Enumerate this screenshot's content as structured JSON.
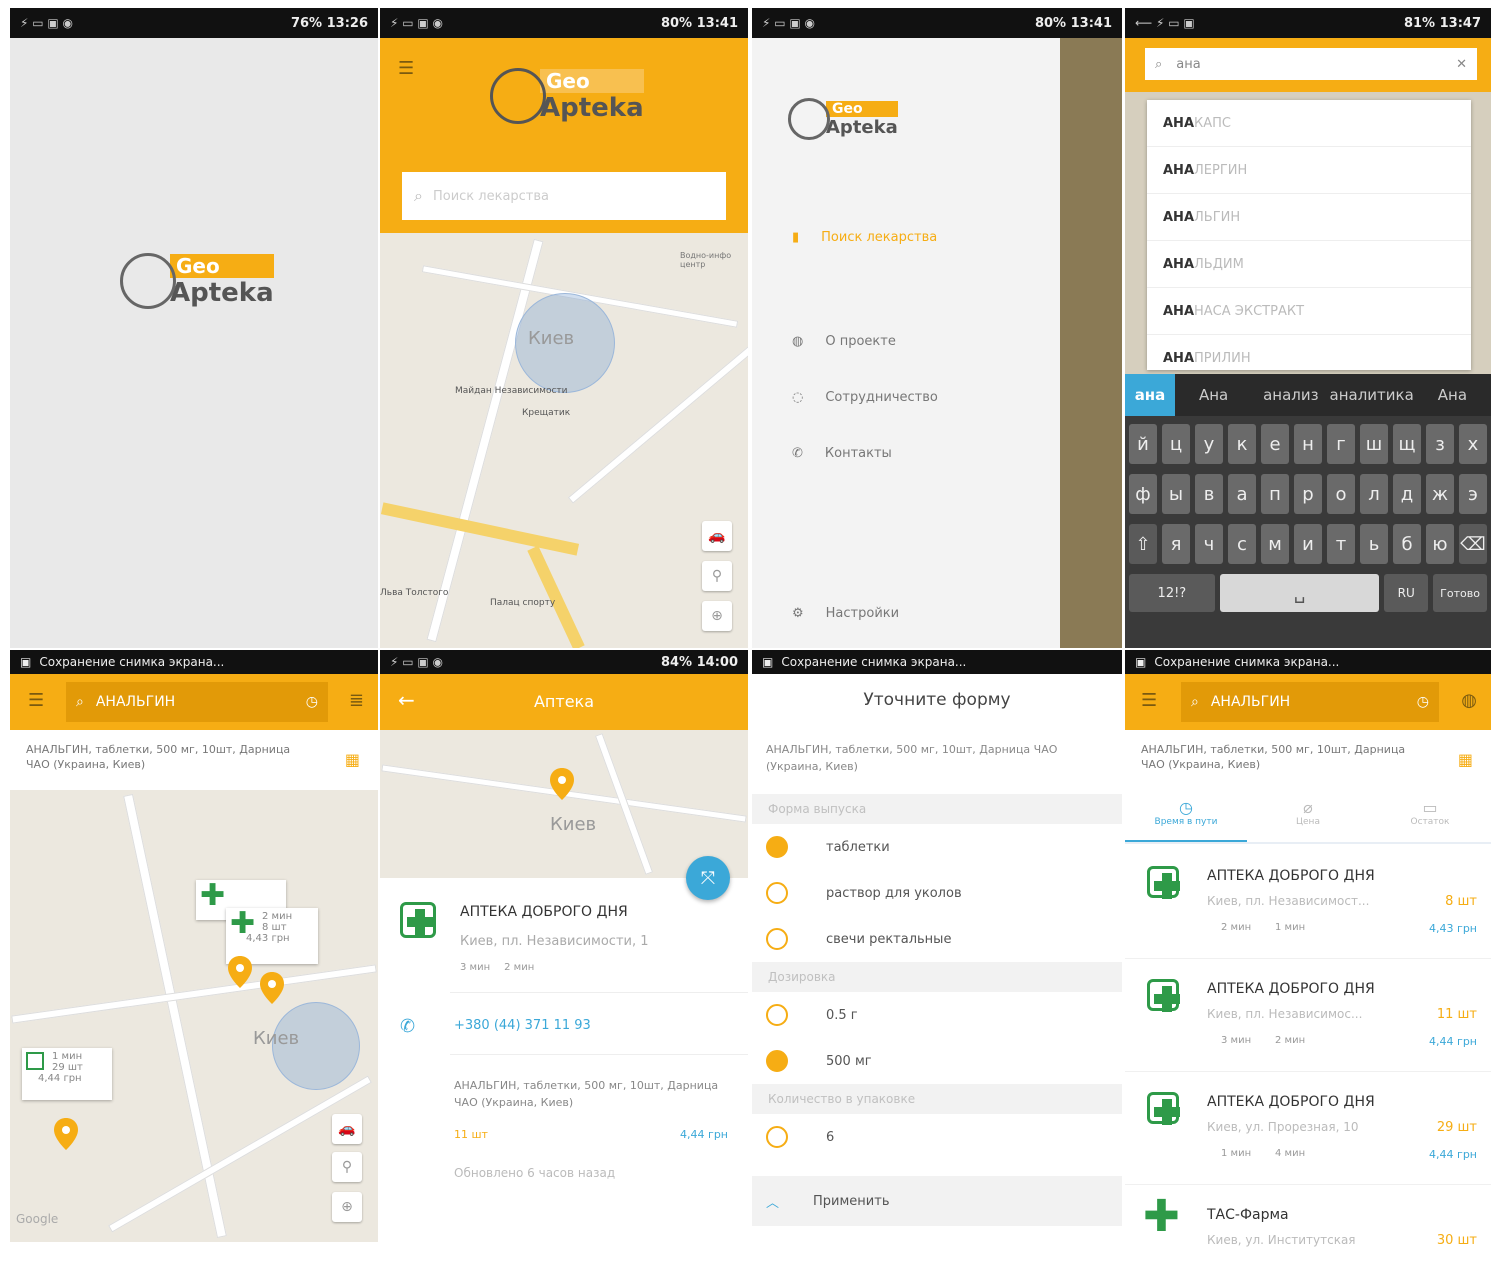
{
  "logo": {
    "geo": "Geo",
    "apteka": "Apteka"
  },
  "status": {
    "s1_time": "13:26",
    "s1_battery": "76%",
    "s2_time": "13:41",
    "s2_battery": "80%",
    "s3_time": "13:41",
    "s3_battery": "80%",
    "s4_time": "13:47",
    "s4_battery": "81%",
    "s6_time": "14:00",
    "s6_battery": "84%"
  },
  "screenshot_notice": "Сохранение снимка экрана...",
  "search": {
    "placeholder": "Поиск лекарства",
    "query": "ана",
    "query_full": "АНАЛЬГИН"
  },
  "map": {
    "city": "Киев",
    "place1": "Майдан Независимости",
    "place2": "Крещатик",
    "place3": "Льва Толстого",
    "place4": "Палац спорту",
    "place5": "Водно-инфо центр",
    "google": "Google"
  },
  "drawer": {
    "search_drugs": "Поиск лекарства",
    "about": "О проекте",
    "cooperation": "Сотрудничество",
    "contacts": "Контакты",
    "settings": "Настройки"
  },
  "suggestions": {
    "prefix": "АНА",
    "items": [
      "КАПС",
      "ЛЕРГИН",
      "ЛЬГИН",
      "ЛЬДИМ",
      "НАСА ЭКСТРАКТ",
      "ПРИЛИН"
    ]
  },
  "keyboard": {
    "predictions": [
      "ана",
      "Ана",
      "анализ",
      "аналитика",
      "Ана"
    ],
    "row1": [
      "й",
      "ц",
      "у",
      "к",
      "е",
      "н",
      "г",
      "ш",
      "щ",
      "з",
      "х"
    ],
    "row2": [
      "ф",
      "ы",
      "в",
      "а",
      "п",
      "р",
      "о",
      "л",
      "д",
      "ж",
      "э"
    ],
    "row3": [
      "я",
      "ч",
      "с",
      "м",
      "и",
      "т",
      "ь",
      "б",
      "ю"
    ],
    "sym": "12!?",
    "lang": "RU",
    "go": "Готово"
  },
  "drug": {
    "desc": "АНАЛЬГИН, таблетки, 500 мг, 10шт, Дарница ЧАО (Украина, Киев)"
  },
  "map_markers": [
    {
      "walk": "2 мин",
      "qty": "8 шт",
      "price": "4,43 грн"
    },
    {
      "walk": "1 мин",
      "qty": "29 шт",
      "price": "4,44 грн"
    }
  ],
  "pharmacy_detail": {
    "title": "Аптека",
    "name": "АПТЕКА ДОБРОГО ДНЯ",
    "address": "Киев, пл. Независимости, 1",
    "walk": "3 мин",
    "drive": "2 мин",
    "phone": "+380 (44) 371 11 93",
    "qty": "11 шт",
    "price": "4,44 грн",
    "updated": "Обновлено 6 часов назад"
  },
  "form": {
    "title": "Уточните форму",
    "sec_form": "Форма выпуска",
    "opts_form": [
      {
        "label": "таблетки",
        "on": true
      },
      {
        "label": "раствор для уколов",
        "on": false
      },
      {
        "label": "свечи ректальные",
        "on": false
      }
    ],
    "sec_dose": "Дозировка",
    "opts_dose": [
      {
        "label": "0.5 г",
        "on": false
      },
      {
        "label": "500 мг",
        "on": true
      }
    ],
    "sec_qty": "Количество в упаковке",
    "opts_qty": [
      {
        "label": "6",
        "on": false
      }
    ],
    "apply": "Применить"
  },
  "tabs": [
    "Время в пути",
    "Цена",
    "Остаток"
  ],
  "pharmacies": [
    {
      "name": "АПТЕКА ДОБРОГО ДНЯ",
      "addr": "Киев, пл. Независимост...",
      "qty": "8 шт",
      "walk": "2 мин",
      "drive": "1 мин",
      "price": "4,43 грн"
    },
    {
      "name": "АПТЕКА ДОБРОГО ДНЯ",
      "addr": "Киев, пл. Независимос...",
      "qty": "11 шт",
      "walk": "3 мин",
      "drive": "2 мин",
      "price": "4,44 грн"
    },
    {
      "name": "АПТЕКА ДОБРОГО ДНЯ",
      "addr": "Киев, ул. Прорезная, 10",
      "qty": "29 шт",
      "walk": "1 мин",
      "drive": "4 мин",
      "price": "4,44 грн"
    },
    {
      "name": "ТАС-Фарма",
      "addr": "Киев, ул. Институтская",
      "qty": "30 шт",
      "walk": "",
      "drive": "",
      "price": ""
    }
  ],
  "colors": {
    "accent": "#f6ad14",
    "green": "#2e9a48",
    "blue": "#3ba8d8"
  }
}
